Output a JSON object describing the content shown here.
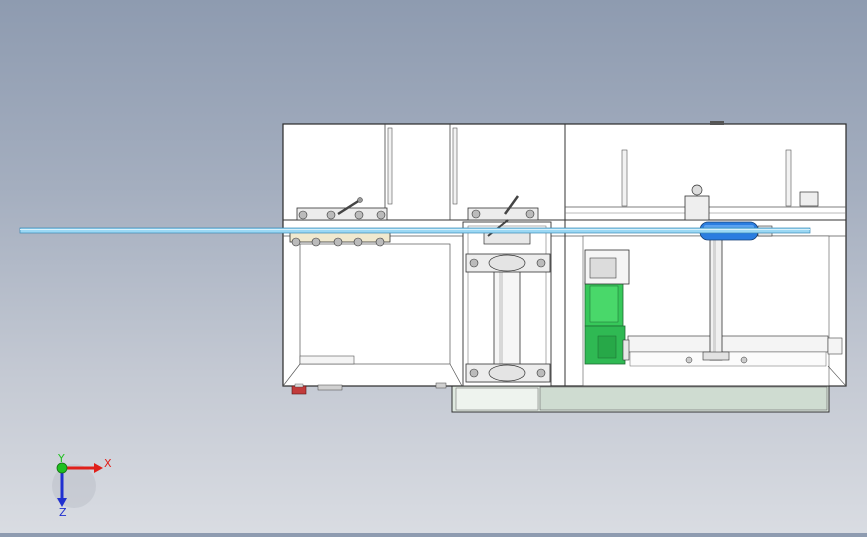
{
  "viewport": {
    "background_top": "#8e9bb0",
    "background_bottom": "#d9dce2"
  },
  "model": {
    "frame_fill": "#ffffff",
    "line_color": "#2a2a2a",
    "rod_color": "#8fd3f0",
    "motor_color": "#34c759",
    "cylinder_color": "#2b7de0",
    "base_plate_color": "#d7e3d9",
    "bolt_color": "#c23b3b"
  },
  "triad": {
    "x_label": "X",
    "y_label": "Y",
    "z_label": "Z",
    "x_color": "#e0201a",
    "y_color": "#20c020",
    "z_color": "#2030d0"
  }
}
